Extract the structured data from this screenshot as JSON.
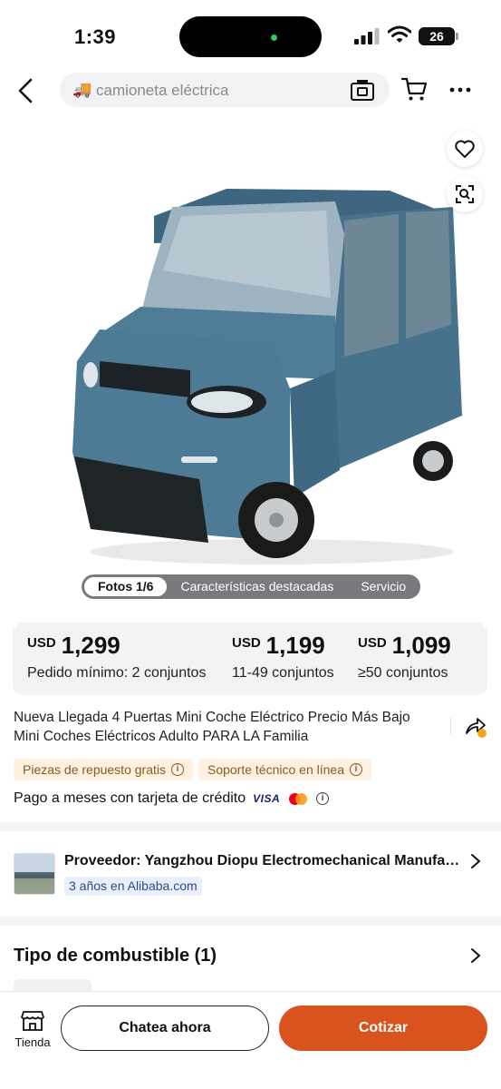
{
  "status_bar": {
    "time": "1:39",
    "battery": "26"
  },
  "search": {
    "query": "camioneta eléctrica",
    "query_icon": "truck-icon"
  },
  "photo_tabs": {
    "photos": "Fotos 1/6",
    "features": "Características destacadas",
    "service": "Servicio"
  },
  "price_tiers": [
    {
      "currency": "USD",
      "amount": "1,299",
      "quantity": "Pedido mínimo: 2 conjuntos"
    },
    {
      "currency": "USD",
      "amount": "1,199",
      "quantity": "11-49 conjuntos"
    },
    {
      "currency": "USD",
      "amount": "1,099",
      "quantity": "≥50 conjuntos"
    }
  ],
  "product": {
    "title": "Nueva Llegada 4 Puertas Mini Coche Eléctrico Precio Más Bajo Mini Coches Eléctricos Adulto PARA LA Familia",
    "badges": [
      "Piezas de repuesto gratis",
      "Soporte técnico en línea"
    ],
    "installments": "Pago a meses con tarjeta de crédito",
    "card_brand": "VISA"
  },
  "supplier": {
    "name": "Proveedor: Yangzhou Diopu Electromechanical Manufac...",
    "years": "3 años en Alibaba.com"
  },
  "fuel": {
    "label": "Tipo de combustible (1)"
  },
  "bottom_bar": {
    "store_label": "Tienda",
    "chat_label": "Chatea ahora",
    "quote_label": "Cotizar"
  },
  "colors": {
    "accent": "#d9531e",
    "badge_bg": "#fdf1e2",
    "badge_text": "#8a5a1e",
    "car_body": "#4d7a95"
  }
}
